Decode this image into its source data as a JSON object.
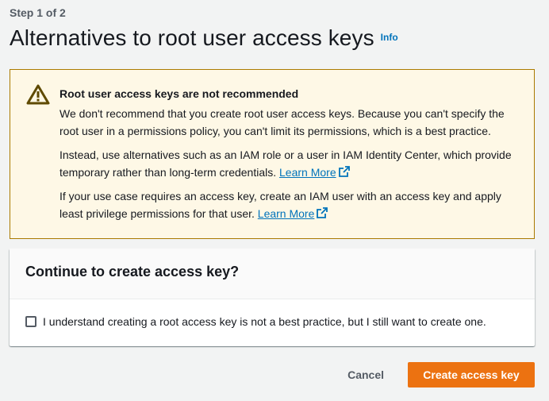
{
  "step_label": "Step 1 of 2",
  "page_title": "Alternatives to root user access keys",
  "info_label": "Info",
  "alert": {
    "heading": "Root user access keys are not recommended",
    "paragraph1": "We don't recommend that you create root user access keys. Because you can't specify the root user in a permissions policy, you can't limit its permissions, which is a best practice.",
    "paragraph2_text": "Instead, use alternatives such as an IAM role or a user in IAM Identity Center, which provide temporary rather than long-term credentials.",
    "paragraph2_link": "Learn More",
    "paragraph3_text": "If your use case requires an access key, create an IAM user with an access key and apply least privilege permissions for that user.",
    "paragraph3_link": "Learn More",
    "icon": "warning-triangle-icon"
  },
  "confirm_panel": {
    "title": "Continue to create access key?",
    "checkbox_label": "I understand creating a root access key is not a best practice, but I still want to create one.",
    "checked": false
  },
  "actions": {
    "cancel_label": "Cancel",
    "primary_label": "Create access key"
  },
  "colors": {
    "accent": "#ec7211",
    "link": "#0073bb",
    "warning_bg": "#fef8e6",
    "warning_border": "#ab7a00"
  }
}
